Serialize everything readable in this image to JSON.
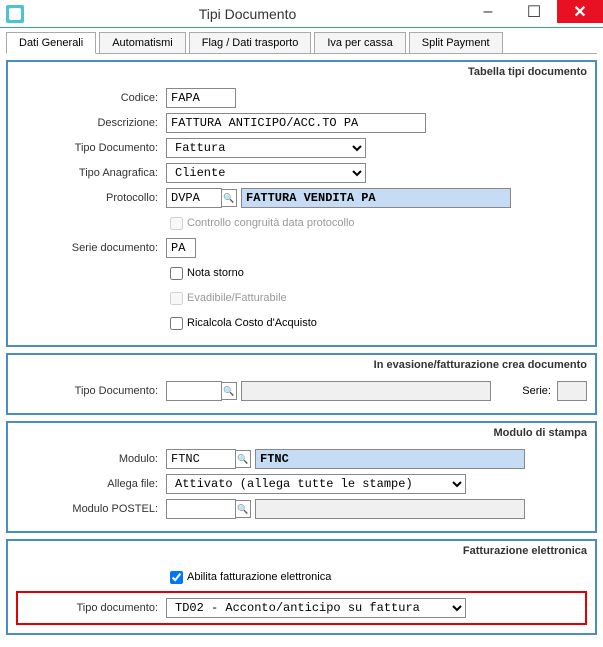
{
  "window": {
    "title": "Tipi Documento",
    "min": "–",
    "max": "☐",
    "close": "✕"
  },
  "tabs": {
    "t1": "Dati Generali",
    "t2": "Automatismi",
    "t3": "Flag / Dati trasporto",
    "t4": "Iva per cassa",
    "t5": "Split Payment"
  },
  "panel1": {
    "title": "Tabella tipi documento",
    "codice_lbl": "Codice:",
    "codice": "FAPA",
    "descrizione_lbl": "Descrizione:",
    "descrizione": "FATTURA ANTICIPO/ACC.TO PA",
    "tipodoc_lbl": "Tipo Documento:",
    "tipodoc": "Fattura",
    "tipoanag_lbl": "Tipo Anagrafica:",
    "tipoanag": "Cliente",
    "protocollo_lbl": "Protocollo:",
    "protocollo_code": "DVPA",
    "protocollo_desc": "FATTURA VENDITA PA",
    "controllo_lbl": "Controllo congruità data protocollo",
    "serie_lbl": "Serie documento:",
    "serie": "PA",
    "nota_lbl": "Nota storno",
    "evadibile_lbl": "Evadibile/Fatturabile",
    "ricalcola_lbl": "Ricalcola Costo d'Acquisto"
  },
  "panel2": {
    "title": "In evasione/fatturazione crea documento",
    "tipodoc_lbl": "Tipo Documento:",
    "serie_lbl": "Serie:"
  },
  "panel3": {
    "title": "Modulo di stampa",
    "modulo_lbl": "Modulo:",
    "modulo_code": "FTNC",
    "modulo_desc": "FTNC",
    "allega_lbl": "Allega file:",
    "allega": "Attivato (allega tutte le stampe)",
    "postel_lbl": "Modulo POSTEL:"
  },
  "panel4": {
    "title": "Fatturazione elettronica",
    "abilita_lbl": "Abilita fatturazione elettronica",
    "tipodoc_lbl": "Tipo documento:",
    "tipodoc": "TD02 - Acconto/anticipo su fattura"
  }
}
